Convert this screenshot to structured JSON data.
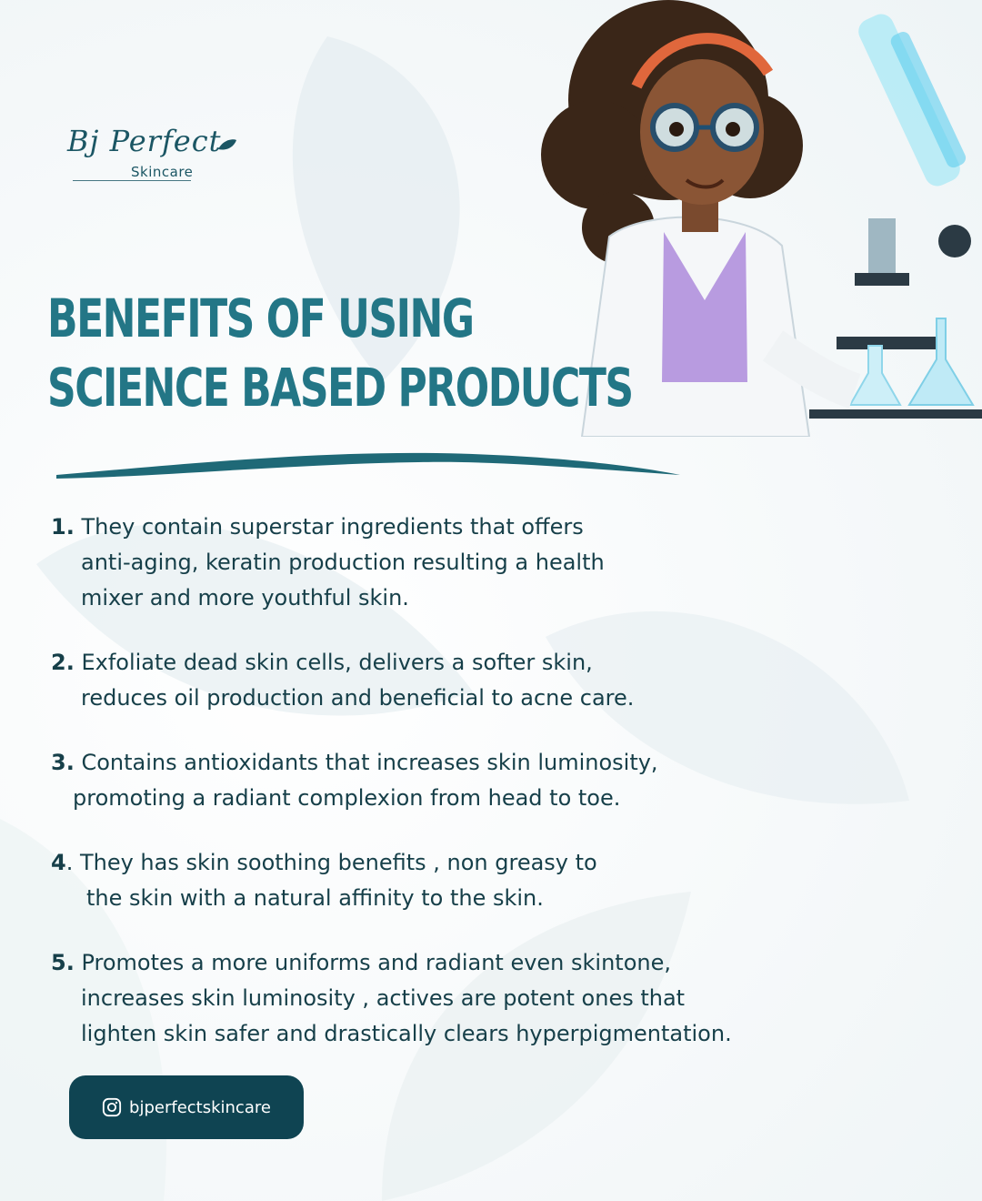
{
  "brand": {
    "logo_script": "Bj Perfect",
    "logo_sub": "Skincare"
  },
  "title": {
    "line1": "BENEFITS OF USING",
    "line2": "SCIENCE BASED PRODUCTS"
  },
  "benefits": [
    {
      "number": "1.",
      "lines": [
        "They contain superstar ingredients that offers",
        "anti-aging, keratin production resulting a health",
        "mixer and more youthful skin."
      ]
    },
    {
      "number": "2.",
      "lines": [
        "Exfoliate dead skin cells, delivers a softer skin,",
        "reduces oil production and beneficial to acne care."
      ]
    },
    {
      "number": "3.",
      "lines": [
        "Contains antioxidants that increases skin luminosity,",
        "promoting a radiant complexion from head to toe."
      ]
    },
    {
      "number": "4",
      "lines": [
        ". They has skin soothing benefits ,  non greasy to",
        "the skin with a natural affinity to the skin."
      ]
    },
    {
      "number": "5.",
      "lines": [
        "Promotes a more uniforms and radiant even skintone,",
        "increases skin luminosity , actives are potent ones that",
        "lighten skin safer and drastically clears hyperpigmentation."
      ]
    }
  ],
  "social": {
    "handle": "bjperfectskincare",
    "icon": "instagram-icon"
  },
  "colors": {
    "title": "#237686",
    "body_text": "#163f49",
    "button_bg": "#0f4452",
    "background": "#f4f8f9"
  }
}
